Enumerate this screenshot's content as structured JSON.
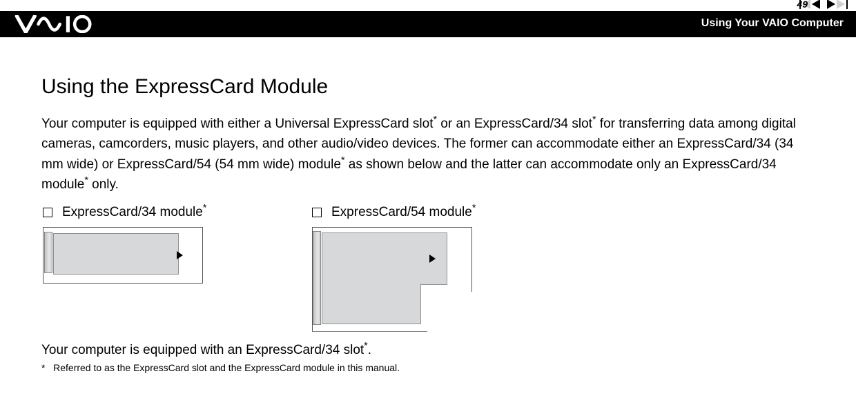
{
  "header": {
    "page_number": "49",
    "section_title": "Using Your VAIO Computer"
  },
  "content": {
    "title": "Using the ExpressCard Module",
    "intro_part1": "Your computer is equipped with either a Universal ExpressCard slot",
    "intro_part2": " or an ExpressCard/34 slot",
    "intro_part3": " for transferring data among digital cameras, camcorders, music players, and other audio/video devices. The former can accommodate either an ExpressCard/34 (34 mm wide) or ExpressCard/54 (54 mm wide) module",
    "intro_part4": " as shown below and the latter can accommodate only an ExpressCard/34 module",
    "intro_part5": " only.",
    "sup": "*",
    "card34_label": "ExpressCard/34 module",
    "card54_label": "ExpressCard/54 module",
    "after_para_part1": "Your computer is equipped with an ExpressCard/34 slot",
    "after_para_part2": ".",
    "footnote_marker": "*",
    "footnote_text": "Referred to as the ExpressCard slot and the ExpressCard module in this manual."
  }
}
